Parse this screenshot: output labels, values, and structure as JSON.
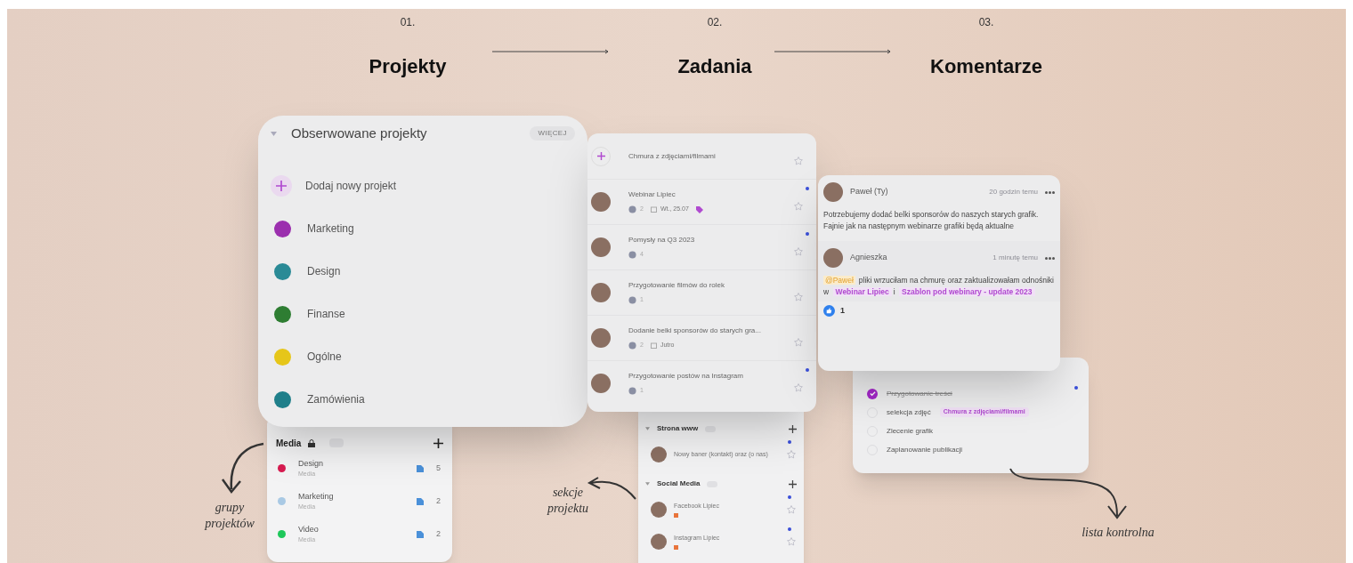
{
  "steps": [
    {
      "number": "01.",
      "title": "Projekty"
    },
    {
      "number": "02.",
      "title": "Zadania"
    },
    {
      "number": "03.",
      "title": "Komentarze"
    }
  ],
  "projects_card": {
    "title": "Obserwowane projekty",
    "more_button": "WIĘCEJ",
    "add_label": "Dodaj nowy projekt",
    "items": [
      {
        "name": "Marketing",
        "color": "#9b2fae"
      },
      {
        "name": "Design",
        "color": "#2a8a96"
      },
      {
        "name": "Finanse",
        "color": "#2e7d32"
      },
      {
        "name": "Ogólne",
        "color": "#e6c619"
      },
      {
        "name": "Zamówienia",
        "color": "#1f7f8a"
      }
    ]
  },
  "media_group": {
    "title": "Media",
    "items": [
      {
        "name": "Design",
        "subtitle": "Media",
        "count": "5",
        "color": "#d81b50"
      },
      {
        "name": "Marketing",
        "subtitle": "Media",
        "count": "2",
        "color": "#a9c9e4"
      },
      {
        "name": "Video",
        "subtitle": "Media",
        "count": "2",
        "color": "#1ec75a"
      }
    ]
  },
  "tasks_card": {
    "items": [
      {
        "kind": "add",
        "title": "Chmura z zdjęciami/filmami",
        "unread": false
      },
      {
        "kind": "task",
        "title": "Webinar Lipiec",
        "comments": "2",
        "date": "Wt., 25.07",
        "tagged": true,
        "unread": true
      },
      {
        "kind": "task",
        "title": "Pomysły na Q3 2023",
        "comments": "4",
        "tagged": false,
        "unread": true
      },
      {
        "kind": "task",
        "title": "Przygotowanie filmów do rolek",
        "comments": "1",
        "tagged": false,
        "unread": false
      },
      {
        "kind": "task",
        "title": "Dodanie belki sponsorów do starych gra...",
        "comments": "2",
        "date": "Jutro",
        "tagged": false,
        "unread": false
      },
      {
        "kind": "task",
        "title": "Przygotowanie postów na Instagram",
        "comments": "1",
        "tagged": false,
        "unread": true
      }
    ]
  },
  "sections_panel": {
    "sections": [
      {
        "title": "Strona www",
        "tasks": [
          {
            "title": "Nowy baner (kontakt) oraz (o nas)",
            "unread": true,
            "flagged": false
          }
        ]
      },
      {
        "title": "Social Media",
        "tasks": [
          {
            "title": "Facebook Lipiec",
            "unread": true,
            "flagged": true
          },
          {
            "title": "Instagram Lipiec",
            "unread": true,
            "flagged": true
          }
        ]
      }
    ]
  },
  "comments_card": {
    "comments": [
      {
        "author": "Paweł (Ty)",
        "time": "20 godzin temu",
        "segments": [
          {
            "kind": "text",
            "text": "Potrzebujemy dodać belki sponsorów do naszych starych grafik. Fajnie jak na następnym webinarze grafiki będą aktualne"
          }
        ]
      },
      {
        "author": "Agnieszka",
        "time": "1 minutę temu",
        "segments": [
          {
            "kind": "mention",
            "text": "@Paweł"
          },
          {
            "kind": "text",
            "text": "pliki wrzuciłam na chmurę oraz zaktualizowałam odnośniki w"
          },
          {
            "kind": "link",
            "text": "Webinar Lipiec"
          },
          {
            "kind": "text",
            "text": "i"
          },
          {
            "kind": "link",
            "text": "Szablon pod webinary - update 2023"
          }
        ]
      }
    ],
    "likes": "1"
  },
  "checklist_card": {
    "unread": true,
    "items": [
      {
        "text": "Przygotowanie treści",
        "checked": true
      },
      {
        "text": "selekcja zdjęć",
        "checked": false,
        "link": "Chmura z zdjęciami/filmami"
      },
      {
        "text": "Zlecenie grafik",
        "checked": false
      },
      {
        "text": "Zaplanowanie publikacji",
        "checked": false
      }
    ]
  },
  "annotations": [
    {
      "text": "grupy projektów"
    },
    {
      "text": "sekcje projektu"
    },
    {
      "text": "lista kontrolna"
    }
  ]
}
